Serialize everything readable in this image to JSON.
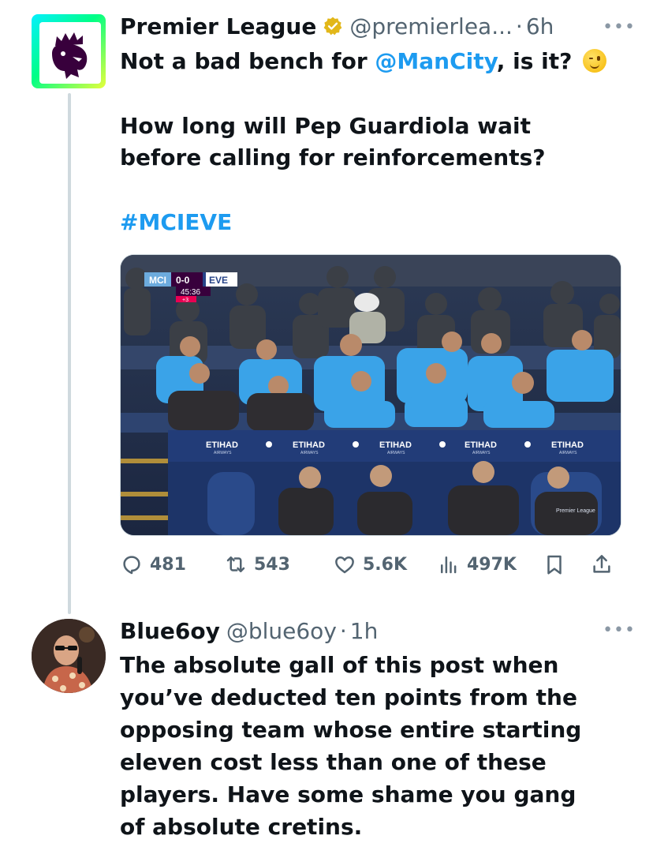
{
  "tweet": {
    "name": "Premier League",
    "handle": "@premierlea...",
    "separator": "·",
    "time": "6h",
    "text_line1_before": "Not a bad bench for ",
    "text_line1_mention": "@ManCity",
    "text_line1_after": ", is it?",
    "paragraph2": "How long will Pep Guardiola wait before calling for reinforcements?",
    "hashtag": "#MCIEVE"
  },
  "media": {
    "score_team_home": "MCI",
    "score": "0-0",
    "score_team_away": "EVE",
    "match_clock": "45:36",
    "added_time": "+3",
    "sponsor": "ETIHAD",
    "sponsor_sub": "AIRWAYS",
    "watermark": "Premier League"
  },
  "stats": {
    "replies": "481",
    "retweets": "543",
    "likes": "5.6K",
    "views": "497K"
  },
  "reply": {
    "name": "Blue6oy",
    "handle": "@blue6oy",
    "separator": "·",
    "time": "1h",
    "text": "The absolute gall of this post when you’ve deducted ten points from the opposing team whose entire starting eleven cost less than one of these players. Have some shame you gang of absolute cretins."
  },
  "colors": {
    "accent": "#1d9bf0",
    "muted": "#536471",
    "thread_line": "#cfd9de",
    "verified_gold": "#e2b719"
  },
  "icons": [
    "reply-icon",
    "retweet-icon",
    "like-icon",
    "views-icon",
    "bookmark-icon",
    "share-icon",
    "verified-badge-icon",
    "more-icon"
  ]
}
